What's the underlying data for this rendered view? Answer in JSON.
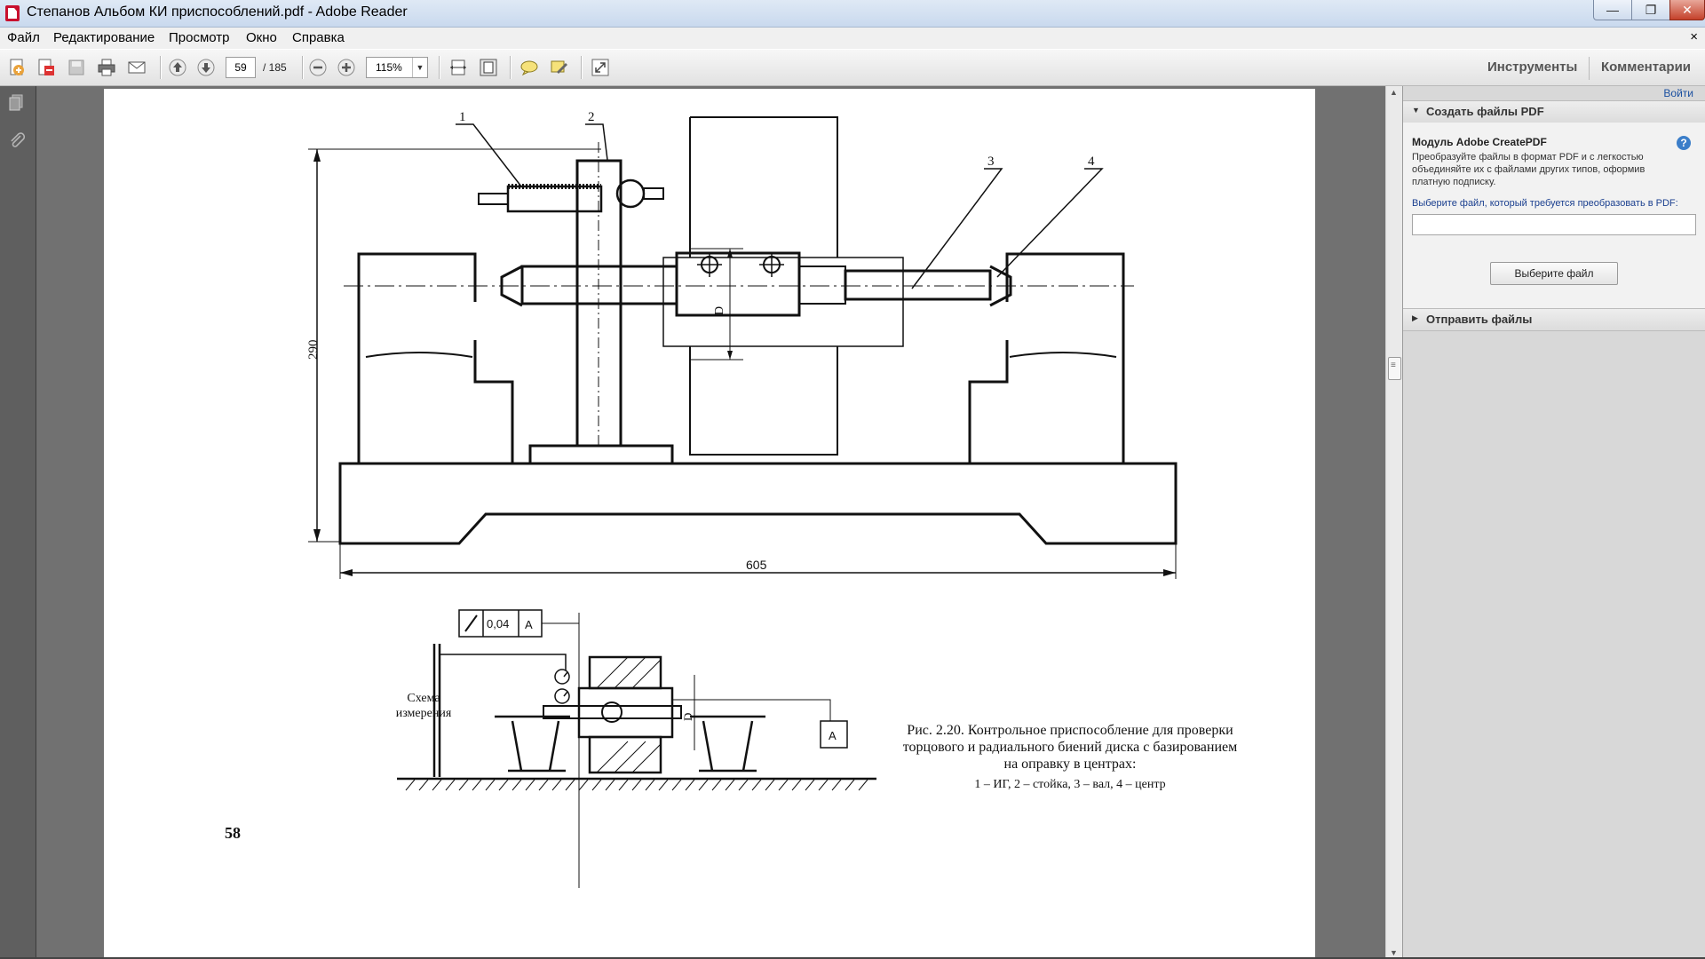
{
  "window": {
    "title": "Степанов Альбом КИ приспособлений.pdf - Adobe Reader",
    "min_symbol": "—",
    "max_symbol": "❐",
    "close_symbol": "✕"
  },
  "menu": {
    "items": [
      "Файл",
      "Редактирование",
      "Просмотр",
      "Окно",
      "Справка"
    ],
    "doc_close": "×"
  },
  "toolbar": {
    "page_current": "59",
    "page_total": "/ 185",
    "zoom": "115%",
    "tools_label": "Инструменты",
    "comments_label": "Комментарии"
  },
  "right_pane": {
    "signin": "Войти",
    "create_pdf": {
      "header": "Создать файлы PDF",
      "module_title": "Модуль Adobe CreatePDF",
      "description": "Преобразуйте файлы в формат PDF и с легкостью объединяйте их с файлами других типов, оформив платную подписку.",
      "choose_label": "Выберите файл, который требуется преобразовать в PDF:",
      "choose_button": "Выберите файл",
      "help": "?"
    },
    "send_files": {
      "header": "Отправить файлы"
    }
  },
  "document": {
    "callouts": [
      "1",
      "2",
      "3",
      "4"
    ],
    "dim_height": "290",
    "dim_width": "605",
    "dim_D": "D",
    "tolerance_value": "0,04",
    "datum": "A",
    "scheme_label_1": "Схема",
    "scheme_label_2": "измерения",
    "caption_line1": "Рис. 2.20. Контрольное приспособление для проверки",
    "caption_line2": "торцового  и радиального биений диска с базированием",
    "caption_line3": "на оправку в центрах:",
    "caption_legend": "1 – ИГ, 2 – стойка, 3 – вал, 4 – центр",
    "page_number": "58"
  }
}
